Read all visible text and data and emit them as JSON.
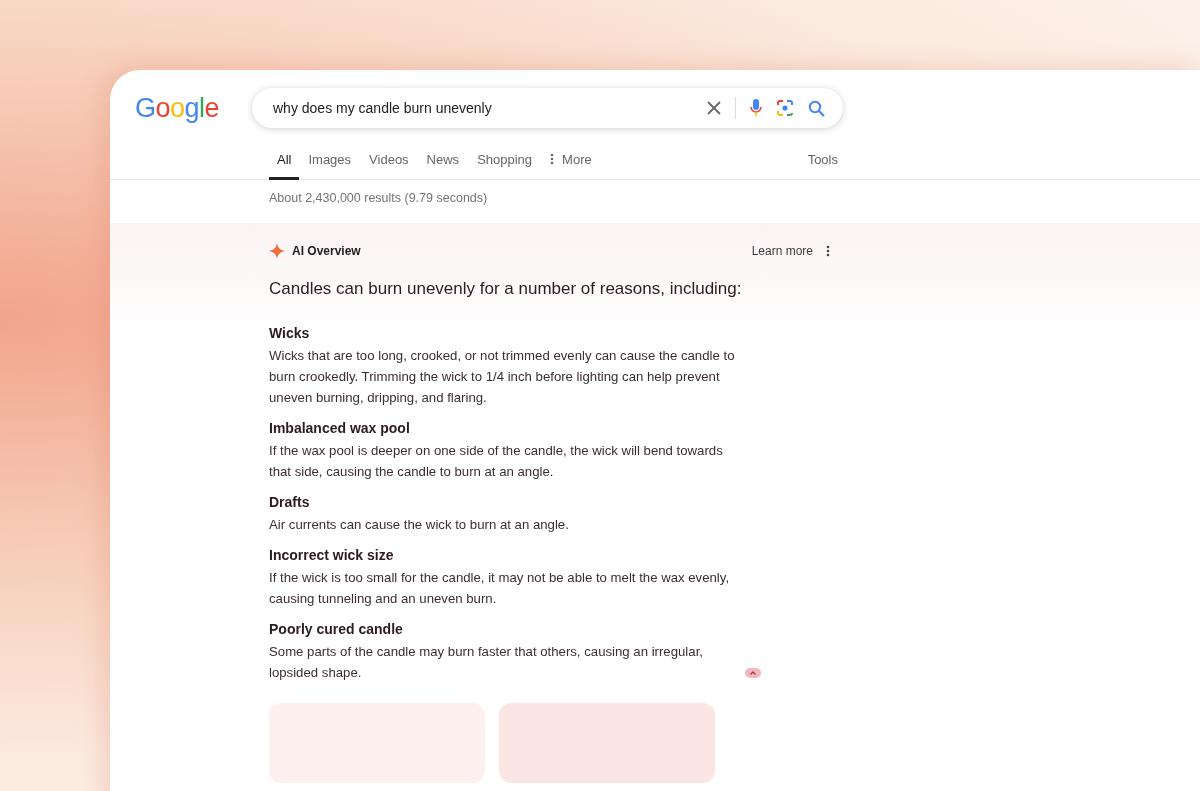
{
  "logo": "Google",
  "search": {
    "value": "why does my candle burn unevenly"
  },
  "tabs": [
    {
      "label": "All",
      "kind": "tab",
      "selected": true
    },
    {
      "label": "Images",
      "kind": "tab",
      "selected": false
    },
    {
      "label": "Videos",
      "kind": "tab",
      "selected": false
    },
    {
      "label": "News",
      "kind": "tab",
      "selected": false
    },
    {
      "label": "Shopping",
      "kind": "tab",
      "selected": false
    },
    {
      "label": "More",
      "kind": "menu",
      "selected": false
    }
  ],
  "tools": "Tools",
  "result_stats": "About 2,430,000 results (9.79 seconds)",
  "ai_overview": {
    "title": "AI Overview",
    "learn_more": "Learn more",
    "lead": "Candles can burn unevenly for a number of reasons, including:",
    "sections": [
      {
        "heading": "Wicks",
        "text": "Wicks that are too long, crooked, or not trimmed evenly can cause the candle to burn crookedly. Trimming the wick to 1/4 inch before lighting can help prevent uneven burning, dripping, and flaring.",
        "source_chip": false
      },
      {
        "heading": "Imbalanced wax pool",
        "text": "If the wax pool is deeper on one side of the candle, the wick will bend towards that side, causing the candle to burn at an angle.",
        "source_chip": false
      },
      {
        "heading": "Drafts",
        "text": "Air currents can cause the wick to burn at an angle.",
        "source_chip": false
      },
      {
        "heading": "Incorrect wick size",
        "text": "If the wick is too small for the candle, it may not be able to melt the wax evenly, causing tunneling and an uneven burn.",
        "source_chip": false
      },
      {
        "heading": "Poorly cured candle",
        "text": "Some parts of the candle may burn faster that others, causing an irregular, lopsided shape.",
        "source_chip": true
      }
    ]
  }
}
